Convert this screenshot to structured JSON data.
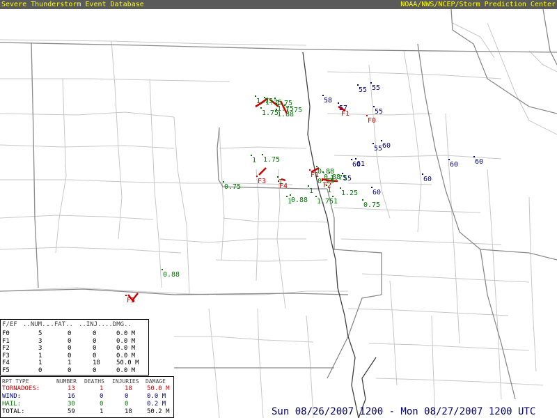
{
  "header": {
    "title": "Severe Thunderstorm Event Database",
    "agency": "NOAA/NWS/NCEP/Storm Prediction Center"
  },
  "colors": {
    "tornado": "#cc0000",
    "wind": "#000080",
    "hail": "#007700",
    "header_bg": "#5a5a5a",
    "header_fg": "#ffff00"
  },
  "reports": {
    "tornado": [
      "F1",
      "F0",
      "F3",
      "F4",
      "F1",
      "F2",
      "F3"
    ],
    "wind": [
      "55",
      "55",
      "58",
      "57",
      "55",
      "55",
      "60",
      "60",
      "61",
      "55",
      "60",
      "60",
      "60",
      "60"
    ],
    "hail": [
      "1.75",
      "1.75",
      "1.75",
      "1.75",
      "1.75",
      "1.75",
      "1.88",
      "1",
      "1.75",
      "0.75",
      "1",
      "1",
      "1",
      "0.88",
      "0.88",
      "1.75",
      "0.75",
      "1.75",
      "1",
      "1",
      "1.25",
      "0.75",
      "0.88",
      "0.88"
    ]
  },
  "fscale_table": {
    "headers": [
      "F/EF",
      "..NUM..",
      "..FAT..",
      "..INJ..",
      "..DMG.."
    ],
    "rows": [
      {
        "scale": "F0",
        "num": "5",
        "fat": "0",
        "inj": "0",
        "dmg": "0.0 M"
      },
      {
        "scale": "F1",
        "num": "3",
        "fat": "0",
        "inj": "0",
        "dmg": "0.0 M"
      },
      {
        "scale": "F2",
        "num": "3",
        "fat": "0",
        "inj": "0",
        "dmg": "0.0 M"
      },
      {
        "scale": "F3",
        "num": "1",
        "fat": "0",
        "inj": "0",
        "dmg": "0.0 M"
      },
      {
        "scale": "F4",
        "num": "1",
        "fat": "1",
        "inj": "18",
        "dmg": "50.0 M"
      },
      {
        "scale": "F5",
        "num": "0",
        "fat": "0",
        "inj": "0",
        "dmg": "0.0 M"
      }
    ]
  },
  "totals_table": {
    "headers": [
      "RPT TYPE",
      "NUMBER",
      "DEATHS",
      "INJURIES",
      "DAMAGE"
    ],
    "rows": [
      {
        "type": "TORNADOES:",
        "number": "13",
        "deaths": "1",
        "injuries": "18",
        "damage": "50.0 M"
      },
      {
        "type": "WIND:",
        "number": "16",
        "deaths": "0",
        "injuries": "0",
        "damage": "0.0 M"
      },
      {
        "type": "HAIL:",
        "number": "30",
        "deaths": "0",
        "injuries": "0",
        "damage": "0.2 M"
      },
      {
        "type": "TOTAL:",
        "number": "59",
        "deaths": "1",
        "injuries": "18",
        "damage": "50.2 M"
      }
    ]
  },
  "date_range": "Sun 08/26/2007 1200 - Mon 08/27/2007 1200 UTC"
}
